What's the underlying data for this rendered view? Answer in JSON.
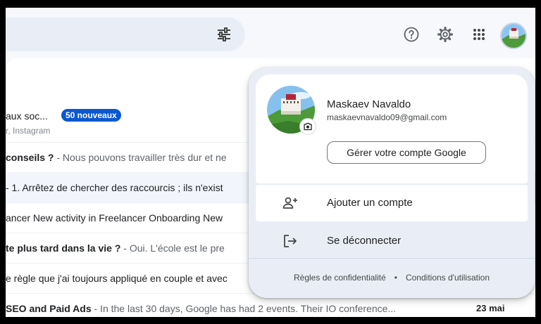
{
  "header": {
    "icons": [
      "tune-icon",
      "help-icon",
      "settings-icon",
      "apps-grid-icon",
      "account-avatar"
    ]
  },
  "inbox": {
    "rows": [
      {
        "subject": "aux soc...",
        "badge": "50 nouveaux",
        "sub": "r, Instagram"
      },
      {
        "subject": "conseils ?",
        "snippet": " - Nous pouvons travailler très dur et ne"
      },
      {
        "subject": "- 1. Arrêtez de chercher des raccourcis ; ils n'exist",
        "snippet": ""
      },
      {
        "subject": "ancer New activity in Freelancer Onboarding New",
        "snippet": ""
      },
      {
        "subject": "te plus tard dans la vie ?",
        "snippet": " - Oui. L'école est le pre"
      },
      {
        "subject": "e règle que j'ai toujours appliqué en couple et avec",
        "snippet": ""
      },
      {
        "subject": "SEO and Paid Ads",
        "snippet": " - In the last 30 days, Google has had 2 events. Their IO conference...",
        "date": "23 mai"
      }
    ]
  },
  "account_panel": {
    "name": "Maskaev Navaldo",
    "email": "maskaevnavaldo09@gmail.com",
    "manage_label": "Gérer votre compte Google",
    "add_account_label": "Ajouter un compte",
    "sign_out_label": "Se déconnecter",
    "privacy_label": "Règles de confidentialité",
    "separator": "•",
    "terms_label": "Conditions d'utilisation"
  },
  "colors": {
    "accent": "#0b57d0",
    "panel_bg": "#e9eef6",
    "search_bg": "#e9eef6"
  }
}
